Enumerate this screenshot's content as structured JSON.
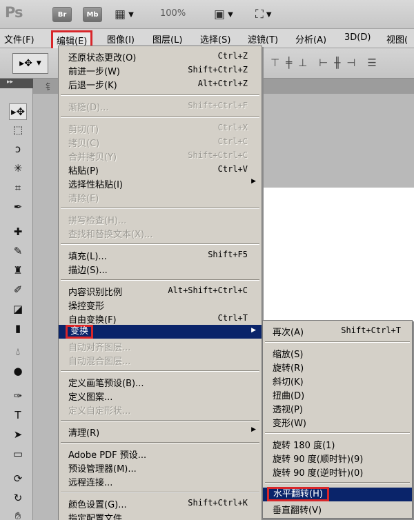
{
  "appbar": {
    "logo": "Ps",
    "bridge_label": "Br",
    "minibridge_label": "Mb",
    "zoom": "100%",
    "icons": [
      "film-icon",
      "layout-icon",
      "screen-mode-icon"
    ]
  },
  "menubar": {
    "items": [
      "文件(F)",
      "编辑(E)",
      "图像(I)",
      "图层(L)",
      "选择(S)",
      "滤镜(T)",
      "分析(A)",
      "3D(D)",
      "视图("
    ],
    "active": "编辑(E)"
  },
  "document": {
    "tab_label": "钅"
  },
  "edit_menu": {
    "items": [
      {
        "label": "还原状态更改(O)",
        "shortcut": "Ctrl+Z",
        "disabled": false
      },
      {
        "label": "前进一步(W)",
        "shortcut": "Shift+Ctrl+Z",
        "disabled": false
      },
      {
        "label": "后退一步(K)",
        "shortcut": "Alt+Ctrl+Z",
        "disabled": false
      },
      {
        "label": "渐隐(D)...",
        "shortcut": "Shift+Ctrl+F",
        "disabled": true
      },
      {
        "label": "剪切(T)",
        "shortcut": "Ctrl+X",
        "disabled": true
      },
      {
        "label": "拷贝(C)",
        "shortcut": "Ctrl+C",
        "disabled": true
      },
      {
        "label": "合并拷贝(Y)",
        "shortcut": "Shift+Ctrl+C",
        "disabled": true
      },
      {
        "label": "粘贴(P)",
        "shortcut": "Ctrl+V",
        "disabled": false
      },
      {
        "label": "选择性粘贴(I)",
        "shortcut": "",
        "disabled": false
      },
      {
        "label": "清除(E)",
        "shortcut": "",
        "disabled": true
      },
      {
        "label": "拼写检查(H)...",
        "shortcut": "",
        "disabled": true
      },
      {
        "label": "查找和替换文本(X)...",
        "shortcut": "",
        "disabled": true
      },
      {
        "label": "填充(L)...",
        "shortcut": "Shift+F5",
        "disabled": false
      },
      {
        "label": "描边(S)...",
        "shortcut": "",
        "disabled": false
      },
      {
        "label": "内容识别比例",
        "shortcut": "Alt+Shift+Ctrl+C",
        "disabled": false
      },
      {
        "label": "操控变形",
        "shortcut": "",
        "disabled": false
      },
      {
        "label": "自由变换(F)",
        "shortcut": "Ctrl+T",
        "disabled": false
      },
      {
        "label": "变换",
        "shortcut": "",
        "disabled": false
      },
      {
        "label": "自动对齐图层...",
        "shortcut": "",
        "disabled": true
      },
      {
        "label": "自动混合图层...",
        "shortcut": "",
        "disabled": true
      },
      {
        "label": "定义画笔预设(B)...",
        "shortcut": "",
        "disabled": false
      },
      {
        "label": "定义图案...",
        "shortcut": "",
        "disabled": false
      },
      {
        "label": "定义自定形状...",
        "shortcut": "",
        "disabled": true
      },
      {
        "label": "清理(R)",
        "shortcut": "",
        "disabled": false
      },
      {
        "label": "Adobe PDF 预设...",
        "shortcut": "",
        "disabled": false
      },
      {
        "label": "预设管理器(M)...",
        "shortcut": "",
        "disabled": false
      },
      {
        "label": "远程连接...",
        "shortcut": "",
        "disabled": false
      },
      {
        "label": "颜色设置(G)...",
        "shortcut": "Shift+Ctrl+K",
        "disabled": false
      },
      {
        "label": "指定配置文件...",
        "shortcut": "",
        "disabled": false
      }
    ]
  },
  "transform_menu": {
    "items": [
      {
        "label": "再次(A)",
        "shortcut": "Shift+Ctrl+T"
      },
      {
        "label": "缩放(S)",
        "shortcut": ""
      },
      {
        "label": "旋转(R)",
        "shortcut": ""
      },
      {
        "label": "斜切(K)",
        "shortcut": ""
      },
      {
        "label": "扭曲(D)",
        "shortcut": ""
      },
      {
        "label": "透视(P)",
        "shortcut": ""
      },
      {
        "label": "变形(W)",
        "shortcut": ""
      },
      {
        "label": "旋转 180 度(1)",
        "shortcut": ""
      },
      {
        "label": "旋转 90 度(顺时针)(9)",
        "shortcut": ""
      },
      {
        "label": "旋转 90 度(逆时针)(0)",
        "shortcut": ""
      },
      {
        "label": "水平翻转(H)",
        "shortcut": ""
      },
      {
        "label": "垂直翻转(V)",
        "shortcut": ""
      }
    ],
    "highlighted": "水平翻转(H)"
  },
  "colors": {
    "menu_bg": "#d4d0c8",
    "highlight": "#0a246a",
    "annotation": "#d8262a"
  }
}
